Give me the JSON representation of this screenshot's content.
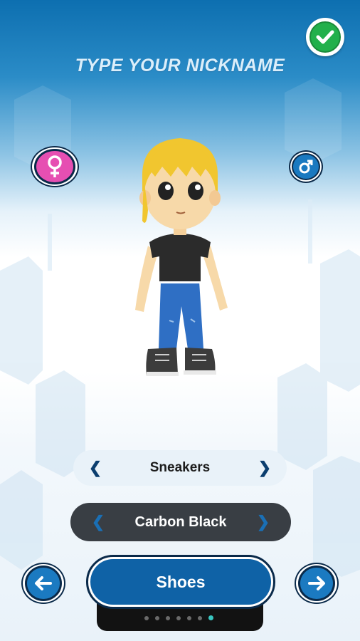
{
  "header": {
    "nickname_placeholder": "TYPE YOUR NICKNAME",
    "confirm_icon": "check-icon"
  },
  "gender": {
    "female_icon": "female-symbol-icon",
    "male_icon": "male-symbol-icon",
    "female_color": "#e64fb2",
    "male_color": "#1a79c0"
  },
  "item_selector": {
    "label": "Sneakers",
    "prev_glyph": "❮",
    "next_glyph": "❯"
  },
  "color_selector": {
    "label": "Carbon Black",
    "prev_glyph": "❮",
    "next_glyph": "❯"
  },
  "category": {
    "label": "Shoes",
    "page_count": 7,
    "active_page": 7
  },
  "navigation": {
    "prev_glyph": "←",
    "next_glyph": "→"
  },
  "colors": {
    "accent_blue": "#0f62a6",
    "confirm_green": "#22b04b",
    "dark_panel": "#393e44"
  }
}
